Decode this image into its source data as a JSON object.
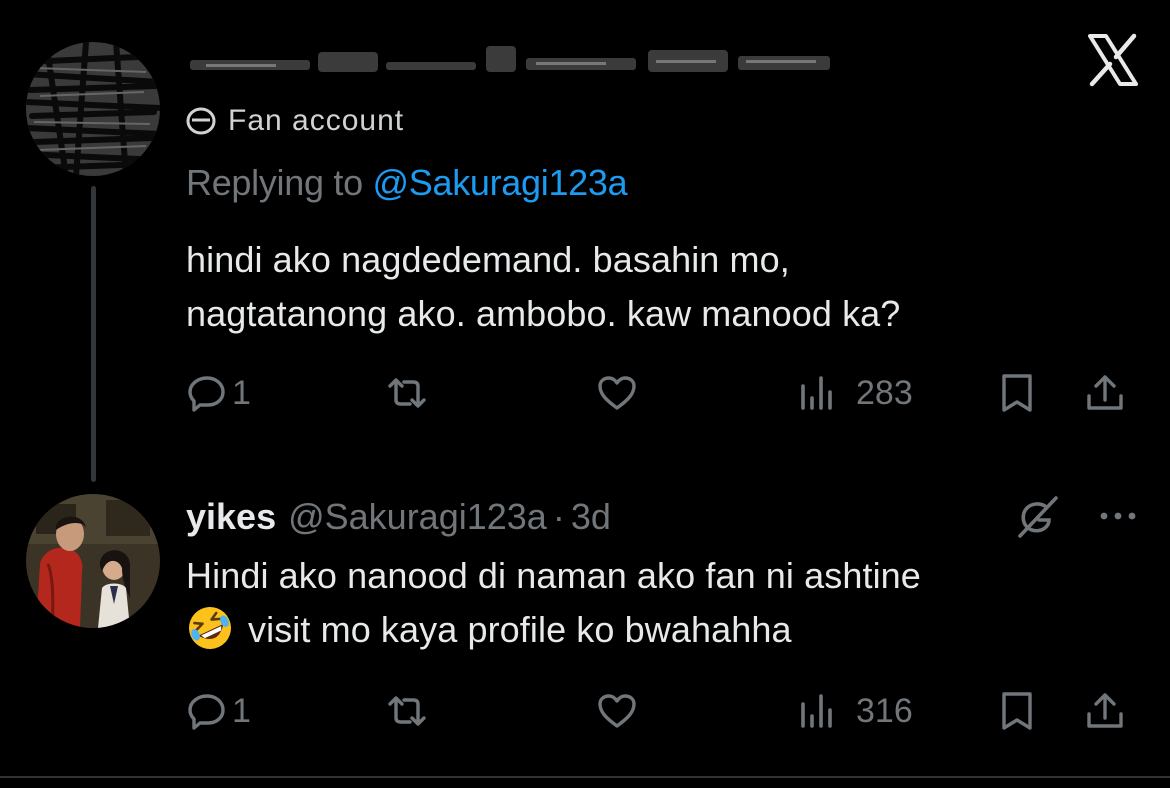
{
  "tweet1": {
    "redacted_name": "",
    "label": "Fan account",
    "replying_prefix": "Replying to",
    "replying_handle": "@Sakuragi123a",
    "text_line1": "hindi ako nagdedemand. basahin mo,",
    "text_line2": "nagtatanong ako. ambobo. kaw manood ka?",
    "reply_count": "1",
    "views_count": "283"
  },
  "tweet2": {
    "display_name": "yikes",
    "handle": "@Sakuragi123a",
    "separator": "·",
    "time": "3d",
    "text_line1": "Hindi ako nanood di naman ako fan ni ashtine",
    "text_line2": "visit mo kaya profile ko bwahahha",
    "reply_count": "1",
    "views_count": "316"
  },
  "icons": {
    "app_logo": "x-logo-icon",
    "reply": "reply-icon",
    "retweet": "retweet-icon",
    "like": "heart-icon",
    "views": "views-icon",
    "bookmark": "bookmark-icon",
    "share": "share-icon",
    "grok": "grok-icon",
    "more": "more-icon",
    "emoji": "rofl-emoji-icon"
  },
  "colors": {
    "background": "#000000",
    "text": "#e7e9ea",
    "muted": "#71767b",
    "link": "#1d9bf0"
  }
}
